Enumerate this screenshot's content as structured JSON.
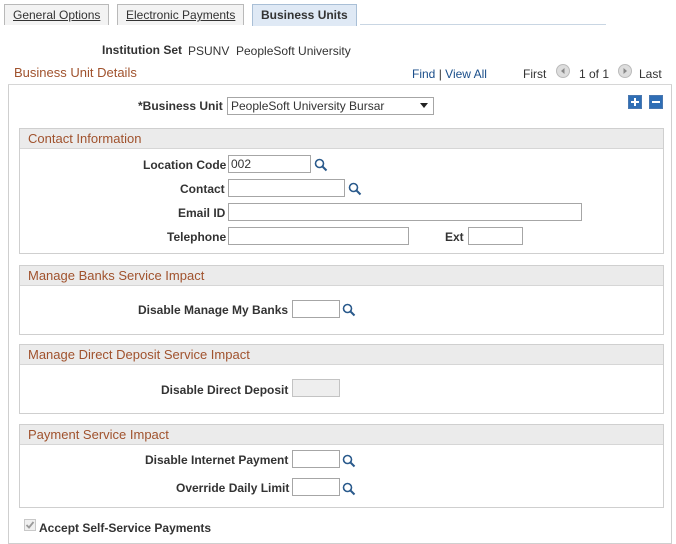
{
  "tabs": [
    {
      "label": "General Options",
      "active": false
    },
    {
      "label": "Electronic Payments",
      "active": false
    },
    {
      "label": "Business Units",
      "active": true
    }
  ],
  "institution_set": {
    "label": "Institution Set",
    "code": "PSUNV",
    "name": "PeopleSoft University"
  },
  "business_unit_details": {
    "title": "Business Unit Details",
    "nav": {
      "find": "Find",
      "separator": "|",
      "view_all": "View All",
      "first": "First",
      "count": "1 of 1",
      "last": "Last"
    },
    "business_unit": {
      "label": "*Business Unit",
      "value": "PeopleSoft University Bursar"
    }
  },
  "contact_information": {
    "title": "Contact Information",
    "location_code": {
      "label": "Location Code",
      "value": "002"
    },
    "contact": {
      "label": "Contact",
      "value": ""
    },
    "email_id": {
      "label": "Email ID",
      "value": ""
    },
    "telephone": {
      "label": "Telephone",
      "value": ""
    },
    "ext": {
      "label": "Ext",
      "value": ""
    }
  },
  "manage_banks": {
    "title": "Manage Banks Service Impact",
    "disable_manage_my_banks": {
      "label": "Disable Manage My Banks",
      "value": ""
    }
  },
  "manage_direct_deposit": {
    "title": "Manage Direct Deposit Service Impact",
    "disable_direct_deposit": {
      "label": "Disable Direct Deposit",
      "value": ""
    }
  },
  "payment_service": {
    "title": "Payment Service Impact",
    "disable_internet_payment": {
      "label": "Disable Internet Payment",
      "value": ""
    },
    "override_daily_limit": {
      "label": "Override Daily Limit",
      "value": ""
    }
  },
  "accept_self_service": {
    "label": "Accept Self-Service Payments",
    "checked": true
  },
  "colors": {
    "accent": "#a0522d",
    "link": "#1a4e8a",
    "tab_active": "#dfe9f5",
    "group_header": "#ebebeb"
  },
  "icons": [
    "search-icon",
    "prev-arrow-icon",
    "next-arrow-icon",
    "add-row-icon",
    "delete-row-icon",
    "checkbox-checked-icon",
    "dropdown-arrow-icon"
  ]
}
